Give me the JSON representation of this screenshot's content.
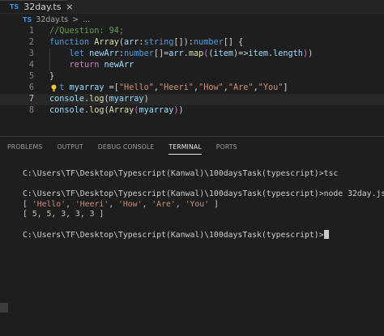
{
  "tab": {
    "lang": "TS",
    "name": "32day.ts",
    "close_icon": "×"
  },
  "breadcrumb": {
    "lang": "TS",
    "file": "32day.ts",
    "sep": ">",
    "more": "..."
  },
  "editor": {
    "line_numbers": [
      "1",
      "2",
      "3",
      "4",
      "5",
      "6",
      "7",
      "8"
    ],
    "lines": [
      [
        [
          "c-comment",
          "//Question: 94;"
        ]
      ],
      [
        [
          "c-kw",
          "function "
        ],
        [
          "c-fn",
          "Array"
        ],
        [
          "c-p",
          "("
        ],
        [
          "c-var",
          "arr"
        ],
        [
          "c-p",
          ":"
        ],
        [
          "c-kw",
          "string"
        ],
        [
          "c-p",
          "[])"
        ],
        [
          "c-p",
          ":"
        ],
        [
          "c-kw",
          "number"
        ],
        [
          "c-p",
          "[] {"
        ]
      ],
      [
        [
          "c-p",
          "    "
        ],
        [
          "c-kw",
          "let "
        ],
        [
          "c-var",
          "newArr"
        ],
        [
          "c-p",
          ":"
        ],
        [
          "c-kw",
          "number"
        ],
        [
          "c-p",
          "[]="
        ],
        [
          "c-var",
          "arr"
        ],
        [
          "c-p",
          "."
        ],
        [
          "c-fn",
          "map"
        ],
        [
          "c-br",
          "("
        ],
        [
          "c-p",
          "("
        ],
        [
          "c-var",
          "item"
        ],
        [
          "c-p",
          ")=>"
        ],
        [
          "c-var",
          "item"
        ],
        [
          "c-p",
          "."
        ],
        [
          "c-var",
          "length"
        ],
        [
          "c-br",
          ")"
        ],
        [
          "c-p",
          ")"
        ]
      ],
      [
        [
          "c-p",
          "    "
        ],
        [
          "c-ctrl",
          "return "
        ],
        [
          "c-var",
          "newArr"
        ]
      ],
      [
        [
          "c-p",
          "}"
        ]
      ],
      [
        [
          "c-p",
          "  "
        ],
        [
          "c-kw",
          "t "
        ],
        [
          "c-var",
          "myarray "
        ],
        [
          "c-p",
          "=["
        ],
        [
          "c-str",
          "\"Hello\""
        ],
        [
          "c-p",
          ","
        ],
        [
          "c-str",
          "\"Heeri\""
        ],
        [
          "c-p",
          ","
        ],
        [
          "c-str",
          "\"How\""
        ],
        [
          "c-p",
          ","
        ],
        [
          "c-str",
          "\"Are\""
        ],
        [
          "c-p",
          ","
        ],
        [
          "c-str",
          "\"You\""
        ],
        [
          "c-p",
          "]"
        ]
      ],
      [
        [
          "c-var",
          "console"
        ],
        [
          "c-p",
          "."
        ],
        [
          "c-fn",
          "log"
        ],
        [
          "c-p",
          "("
        ],
        [
          "c-var",
          "myarray"
        ],
        [
          "c-p",
          ")"
        ]
      ],
      [
        [
          "c-var",
          "console"
        ],
        [
          "c-p",
          "."
        ],
        [
          "c-fn",
          "log"
        ],
        [
          "c-p",
          "("
        ],
        [
          "c-fn",
          "Array"
        ],
        [
          "c-br",
          "("
        ],
        [
          "c-var",
          "myarray"
        ],
        [
          "c-br",
          ")"
        ],
        [
          "c-p",
          ")"
        ]
      ]
    ],
    "current_line_index": 6
  },
  "panel": {
    "tabs": [
      "PROBLEMS",
      "OUTPUT",
      "DEBUG CONSOLE",
      "TERMINAL",
      "PORTS"
    ],
    "active_tab": "TERMINAL"
  },
  "terminal": {
    "lines": [
      {
        "text": "C:\\Users\\TF\\Desktop\\Typescript(Kanwal)\\100daysTask(typescript)>tsc"
      },
      {
        "text": ""
      },
      {
        "text": "C:\\Users\\TF\\Desktop\\Typescript(Kanwal)\\100daysTask(typescript)>node 32day.js"
      },
      {
        "text": "[ 'Hello', 'Heeri', 'How', 'Are', 'You' ]"
      },
      {
        "text": "[ 5, 5, 3, 3, 3 ]"
      },
      {
        "text": ""
      },
      {
        "text": "C:\\Users\\TF\\Desktop\\Typescript(Kanwal)\\100daysTask(typescript)>"
      }
    ]
  },
  "colors": {
    "background": "#1e1e1e",
    "keyword": "#569cd6",
    "string": "#ce9178",
    "function": "#dcdcaa",
    "variable": "#9cdcfe",
    "comment": "#6a9955"
  }
}
